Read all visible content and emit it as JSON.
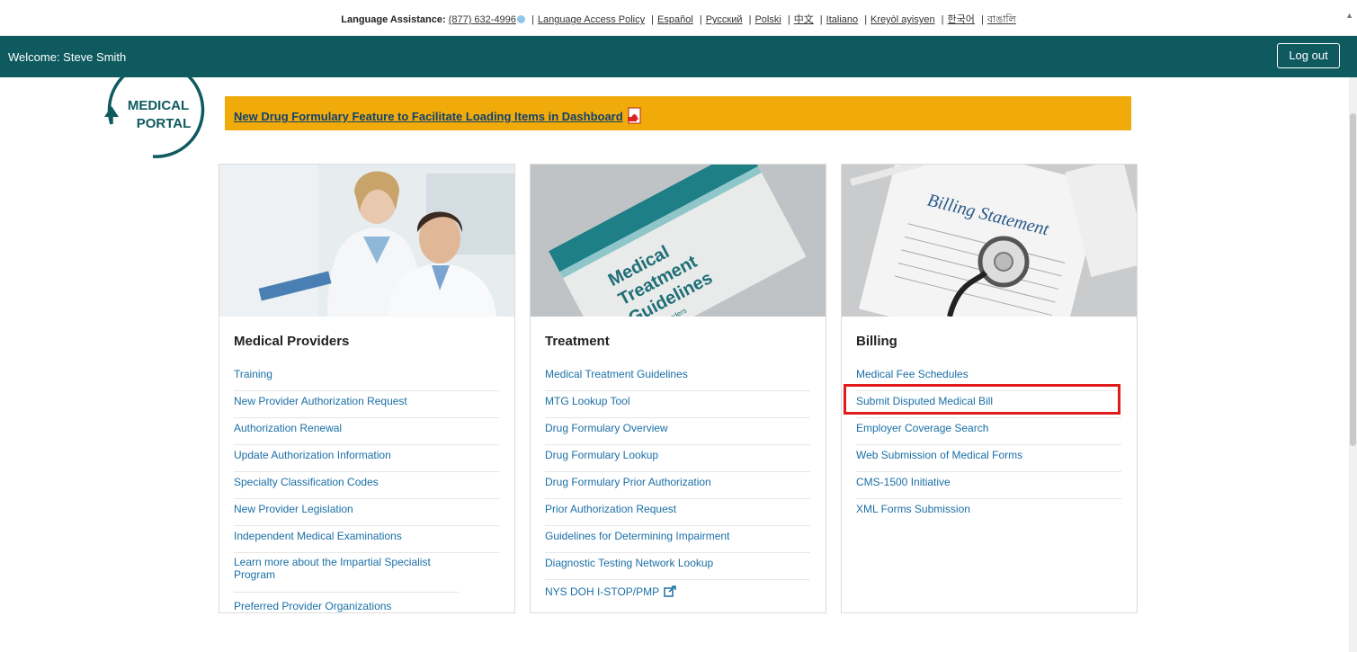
{
  "lang_bar": {
    "lead": "Language Assistance:",
    "phone": "(877) 632-4996",
    "items": [
      "Language Access Policy",
      "Español",
      "Русский",
      "Polski",
      "中文",
      "Italiano",
      "Kreyòl ayisyen",
      "한국어",
      "বাঙালি"
    ]
  },
  "header": {
    "welcome": "Welcome: Steve Smith",
    "logout_label": "Log out",
    "color": "#0e5a5f"
  },
  "logo": {
    "line1": "MEDICAL",
    "line2": "PORTAL"
  },
  "banner": {
    "text": "New Drug Formulary Feature to Facilitate Loading Items in Dashboard",
    "icon": "pdf-icon",
    "color": "#f0ab0a"
  },
  "cards": [
    {
      "title": "Medical Providers",
      "image": "doctors-photo",
      "links": [
        "Training",
        "New Provider Authorization Request",
        "Authorization Renewal",
        "Update Authorization Information",
        "Specialty Classification Codes",
        "New Provider Legislation",
        "Independent Medical Examinations",
        "Learn more about the Impartial Specialist Program",
        "Preferred Provider Organizations"
      ]
    },
    {
      "title": "Treatment",
      "image": "guidelines-book-photo",
      "image_text": {
        "line1": "Medical",
        "line2": "Treatment",
        "line3": "Guidelines",
        "line4": "Elbow Disorders"
      },
      "links": [
        "Medical Treatment Guidelines",
        "MTG Lookup Tool",
        "Drug Formulary Overview",
        "Drug Formulary Lookup",
        "Drug Formulary Prior Authorization",
        "Prior Authorization Request",
        "Guidelines for Determining Impairment",
        "Diagnostic Testing Network Lookup",
        "NYS DOH I-STOP/PMP"
      ]
    },
    {
      "title": "Billing",
      "image": "billing-statement-photo",
      "image_text": "Billing Statement",
      "links": [
        "Medical Fee Schedules",
        "Submit Disputed Medical Bill",
        "Employer Coverage Search",
        "Web Submission of Medical Forms",
        "CMS-1500 Initiative",
        "XML Forms Submission"
      ]
    }
  ],
  "highlight_color": "#e01c1c"
}
